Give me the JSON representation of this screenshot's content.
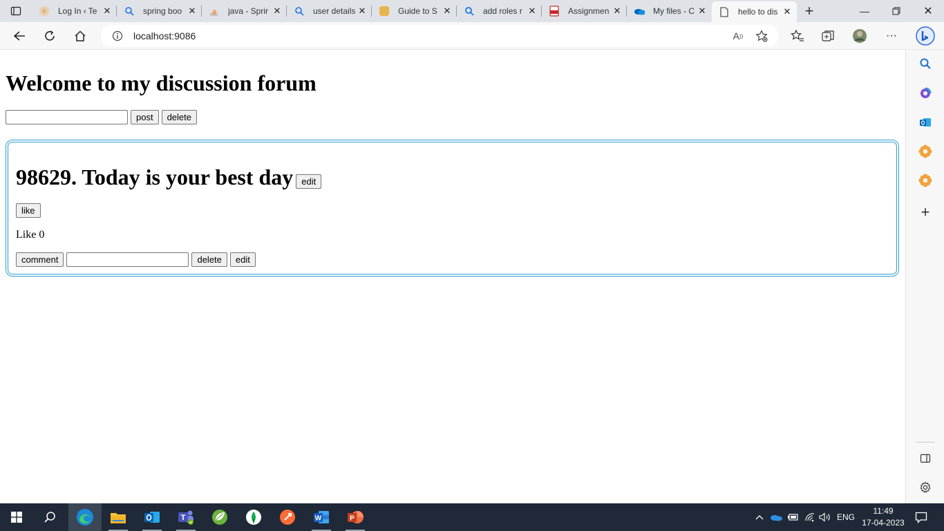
{
  "browser": {
    "tabs": [
      {
        "label": "Log In ‹ Te",
        "icon": "web-icon"
      },
      {
        "label": "spring boo",
        "icon": "search-icon"
      },
      {
        "label": "java - Sprir",
        "icon": "stackoverflow-icon"
      },
      {
        "label": "user details",
        "icon": "search-icon"
      },
      {
        "label": "Guide to S",
        "icon": "baeldung-icon"
      },
      {
        "label": "add roles r",
        "icon": "search-icon"
      },
      {
        "label": "Assignmen",
        "icon": "pdf-icon"
      },
      {
        "label": "My files - C",
        "icon": "onedrive-icon"
      },
      {
        "label": "hello to dis",
        "icon": "page-icon"
      }
    ],
    "active_tab_index": 8,
    "url": "localhost:9086",
    "read_aloud_label": "A"
  },
  "page": {
    "title": "Welcome to my discussion forum",
    "post_input_value": "",
    "post_button": "post",
    "delete_button": "delete",
    "post": {
      "heading": "98629. Today is your best day",
      "edit_button": "edit",
      "like_button": "like",
      "like_count_text": "Like 0",
      "comment_button": "comment",
      "comment_input_value": "",
      "comment_delete_button": "delete",
      "comment_edit_button": "edit"
    }
  },
  "taskbar": {
    "language": "ENG",
    "time": "11:49",
    "date": "17-04-2023"
  },
  "colors": {
    "accent": "#2d9bd6",
    "tabbar": "#dfe3e8",
    "taskbar": "#1f2937"
  }
}
